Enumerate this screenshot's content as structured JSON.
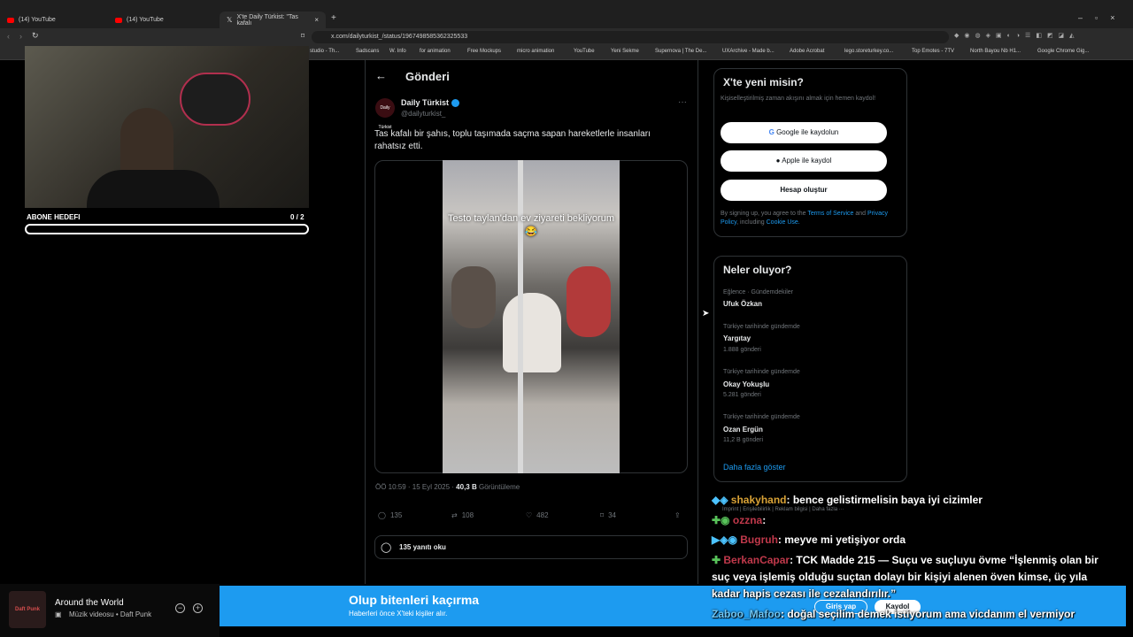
{
  "browser": {
    "tabs": [
      {
        "label": "(14) YouTube"
      },
      {
        "label": "(14) YouTube"
      },
      {
        "label": "X'te Daily Türkist: \"Tas kafalı"
      }
    ],
    "url": "x.com/dailyturkist_/status/1967498585362325533",
    "bookmarks": [
      "studio - Th...",
      "Sadscans",
      "W. Info",
      "for animation",
      "Free Mockups",
      "micro animation",
      "YouTube",
      "Yeni Sekme",
      "Supernova | The De...",
      "UXArchive - Made b...",
      "Adobe Acrobat",
      "lego.storeturkey.co...",
      "Top Emotes - 7TV",
      "North Bayou Nb H1...",
      "Google Chrome Gig..."
    ]
  },
  "stream": {
    "goal_label": "ABONE HEDEFI",
    "goal_count": "0 / 2",
    "goal_progress": 0
  },
  "post": {
    "header": "Gönderi",
    "author_name": "Daily Türkist",
    "author_handle": "@dailyturkist_",
    "avatar_text": "Daily Türkist",
    "text": "Tas kafalı bir şahıs, toplu taşımada saçma sapan hareketlerle insanları rahatsız etti.",
    "video_caption": "Testo taylan'dan ev ziyareti bekliyorum 😂",
    "time": "ÖÖ 10:59 · 15 Eyl 2025 · ",
    "views": "40,3 B",
    "views_label": " Görüntüleme",
    "replies": "135",
    "reposts": "108",
    "likes": "482",
    "bookmarks": "34",
    "read_replies": "135 yanıtı oku"
  },
  "signup": {
    "title": "X'te yeni misin?",
    "subtitle": "Kişiselleştirilmiş zaman akışını almak için hemen kaydol!",
    "google": "Google ile kaydolun",
    "apple": "Apple ile kaydol",
    "create": "Hesap oluştur",
    "terms_pre": "By signing up, you agree to the ",
    "terms": "Terms of Service",
    "terms_and": " and ",
    "privacy": "Privacy Policy",
    "including": ", including ",
    "cookie": "Cookie Use."
  },
  "trends": {
    "title": "Neler oluyor?",
    "items": [
      {
        "category": "Eğlence · Gündemdekiler",
        "name": "Ufuk Özkan",
        "count": ""
      },
      {
        "category": "Türkiye tarihinde gündemde",
        "name": "Yargıtay",
        "count": "1.888 gönderi"
      },
      {
        "category": "Türkiye tarihinde gündemde",
        "name": "Okay Yokuşlu",
        "count": "5.281 gönderi"
      },
      {
        "category": "Türkiye tarihinde gündemde",
        "name": "Ozan Ergün",
        "count": "11,2 B gönderi"
      }
    ],
    "more": "Daha fazla göster"
  },
  "footer_links": "Imprint  |  Erişilebilirlik  |  Reklam bilgisi  |  Daha fazla ···",
  "chat": [
    {
      "user": "shakyhand",
      "text": ": bence gelistirmelisin baya iyi cizimler",
      "color": "#e3a33b"
    },
    {
      "user": "ozzna",
      "text": ": ",
      "color": "#c0394b"
    },
    {
      "user": "Bugruh",
      "text": ": meyve mi yetişiyor orda",
      "color": "#c0394b"
    },
    {
      "user": "BerkanCapar",
      "text": ": TCK Madde 215 — Suçu ve suçluyu övme “İşlenmiş olan bir",
      "color": "#c0394b"
    },
    {
      "user": "",
      "text": "suç veya işlemiş olduğu suçtan dolayı bir kişiyi alenen öven kimse, üç yıla",
      "color": "#ffffff"
    },
    {
      "user": "",
      "text": "kadar hapis cezası ile cezalandırılır.”",
      "color": "#ffffff"
    },
    {
      "user": "Zaboo_Mafoo",
      "text": ": doğal seçilim demek istiyorum ama vicdanım el vermiyor",
      "color": "#6ec6f5"
    }
  ],
  "banner": {
    "title": "Olup bitenleri kaçırma",
    "subtitle": "Haberleri önce X'teki kişiler alır.",
    "login": "Giriş yap",
    "signup": "Kaydol"
  },
  "music": {
    "title": "Around the World",
    "subtitle": "Müzik videosu • Daft Punk",
    "art_text": "Daft Punk"
  }
}
